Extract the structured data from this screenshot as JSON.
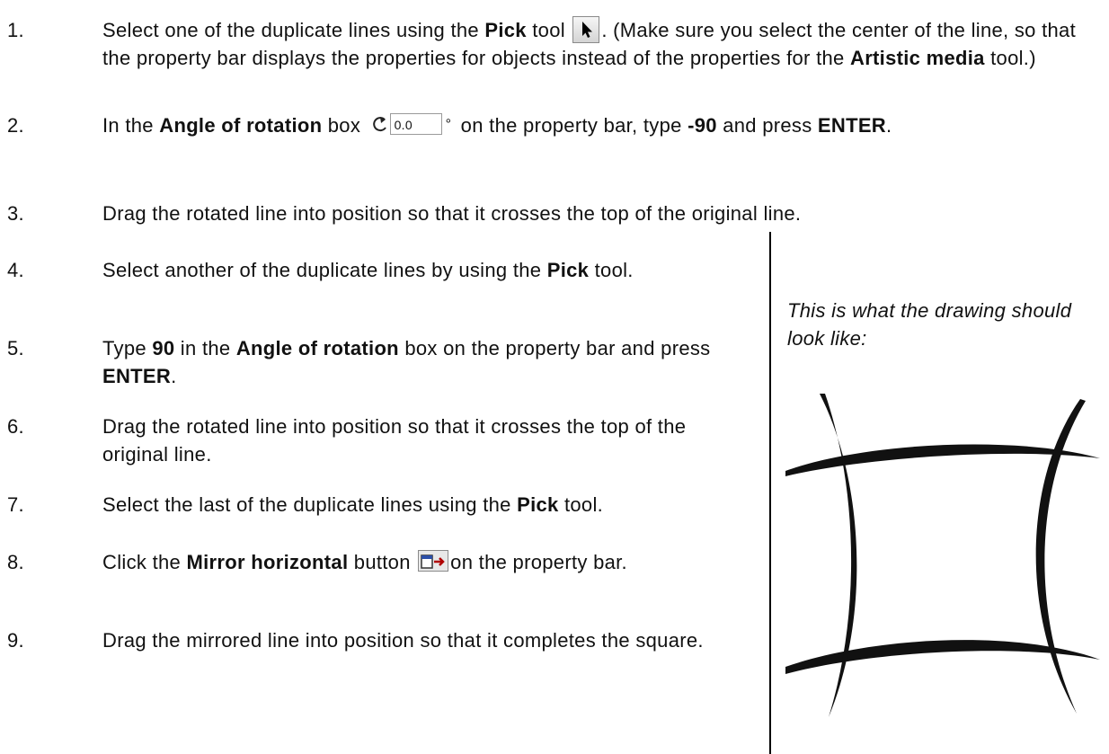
{
  "steps": [
    {
      "num": "1.",
      "parts": [
        "Select one of the duplicate lines using the ",
        "Pick",
        " tool ",
        ". (Make sure you select the center of the line, so that the property bar displays the properties for objects instead of the properties for the ",
        "Artistic media",
        " tool.)"
      ]
    },
    {
      "num": "2.",
      "parts": [
        "In the ",
        "Angle of rotation",
        " box ",
        " on the property bar, type ",
        "-90",
        " and press ",
        "ENTER",
        "."
      ],
      "angle_value": "0.0",
      "angle_unit": "°"
    },
    {
      "num": "3.",
      "parts": [
        "Drag the rotated line into position so that it crosses the top of the original line."
      ]
    },
    {
      "num": "4.",
      "parts": [
        "Select another of the duplicate lines by using the ",
        "Pick",
        " tool."
      ]
    },
    {
      "num": "5.",
      "parts": [
        "Type ",
        "90",
        " in the ",
        "Angle of rotation",
        " box on the property bar and press ",
        "ENTER",
        "."
      ]
    },
    {
      "num": "6.",
      "parts": [
        "Drag the rotated line into position so that it crosses the top of the original line."
      ]
    },
    {
      "num": "7.",
      "parts": [
        "Select the last of the duplicate lines using the ",
        "Pick",
        " tool."
      ]
    },
    {
      "num": "8.",
      "parts": [
        "Click the ",
        "Mirror horizontal",
        " button ",
        "on the property bar."
      ]
    },
    {
      "num": "9.",
      "parts": [
        "Drag the mirrored line into position so that it completes the square."
      ]
    }
  ],
  "caption": "This is what the drawing should look like:",
  "icons": {
    "pick": "pick-tool-arrow-icon",
    "rotation": "rotate-ccw-icon",
    "mirror": "mirror-horizontal-icon"
  }
}
